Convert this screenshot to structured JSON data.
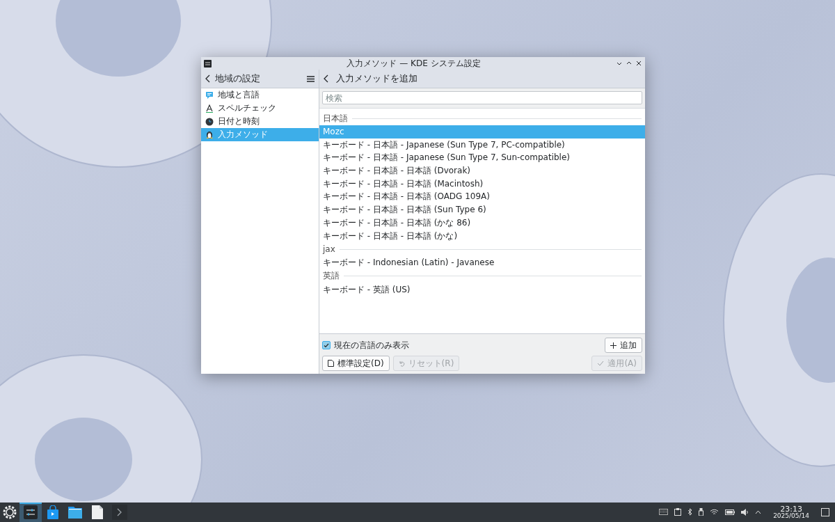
{
  "window": {
    "title": "入力メソッド — KDE システム設定"
  },
  "sidebar": {
    "title": "地域の設定",
    "items": [
      {
        "label": "地域と言語",
        "kind": "region",
        "selected": false
      },
      {
        "label": "スペルチェック",
        "kind": "spell",
        "selected": false
      },
      {
        "label": "日付と時刻",
        "kind": "clock",
        "selected": false
      },
      {
        "label": "入力メソッド",
        "kind": "input",
        "selected": true
      }
    ]
  },
  "page": {
    "title": "入力メソッドを追加",
    "search": {
      "placeholder": "検索"
    },
    "groups": [
      {
        "label": "日本語",
        "items": [
          {
            "label": "Mozc",
            "selected": true
          },
          {
            "label": "キーボード - 日本語 - Japanese (Sun Type 7, PC-compatible)",
            "selected": false
          },
          {
            "label": "キーボード - 日本語 - Japanese (Sun Type 7, Sun-compatible)",
            "selected": false
          },
          {
            "label": "キーボード - 日本語 - 日本語 (Dvorak)",
            "selected": false
          },
          {
            "label": "キーボード - 日本語 - 日本語 (Macintosh)",
            "selected": false
          },
          {
            "label": "キーボード - 日本語 - 日本語 (OADG 109A)",
            "selected": false
          },
          {
            "label": "キーボード - 日本語 - 日本語 (Sun Type 6)",
            "selected": false
          },
          {
            "label": "キーボード - 日本語 - 日本語 (かな 86)",
            "selected": false
          },
          {
            "label": "キーボード - 日本語 - 日本語 (かな)",
            "selected": false
          }
        ]
      },
      {
        "label": "jax",
        "items": [
          {
            "label": "キーボード - Indonesian (Latin) - Javanese",
            "selected": false
          }
        ]
      },
      {
        "label": "英語",
        "items": [
          {
            "label": "キーボード - 英語 (US)",
            "selected": false
          }
        ]
      }
    ],
    "show_current_only": {
      "label": "現在の言語のみ表示",
      "checked": true
    },
    "add_button": {
      "label": "追加",
      "disabled": false
    },
    "defaults_button": {
      "label": "標準設定(D)",
      "disabled": false
    },
    "reset_button": {
      "label": "リセット(R)",
      "disabled": true
    },
    "apply_button": {
      "label": "適用(A)",
      "disabled": true
    }
  },
  "taskbar": {
    "tasks": [
      {
        "kind": "settings",
        "selected": true
      },
      {
        "kind": "store",
        "selected": false
      },
      {
        "kind": "folder",
        "selected": false
      },
      {
        "kind": "document",
        "selected": false
      },
      {
        "kind": "terminal",
        "selected": false
      }
    ],
    "time": "23:13",
    "date": "2025/05/14"
  }
}
